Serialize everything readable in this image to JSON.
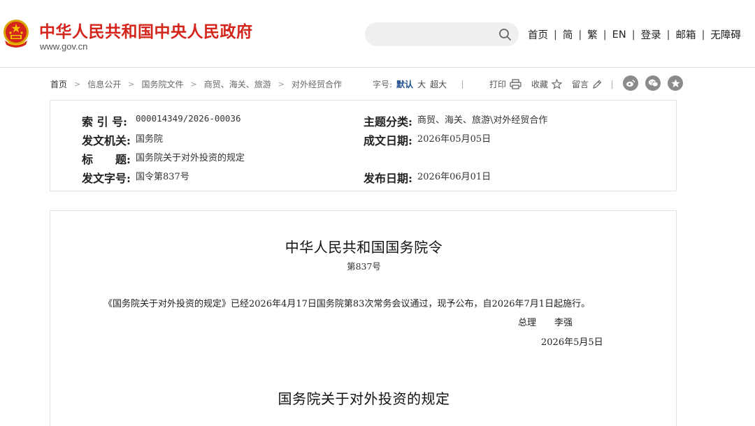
{
  "header": {
    "site_title": "中华人民共和国中央人民政府",
    "site_url": "www.gov.cn",
    "search": {
      "placeholder": ""
    },
    "nav": [
      {
        "label": "首页"
      },
      {
        "label": "简"
      },
      {
        "label": "繁"
      },
      {
        "label": "EN"
      },
      {
        "label": "登录"
      },
      {
        "label": "邮箱"
      },
      {
        "label": "无障碍"
      }
    ],
    "nav_separator": "|"
  },
  "breadcrumb": {
    "items": [
      "首页",
      "信息公开",
      "国务院文件",
      "商贸、海关、旅游",
      "对外经贸合作"
    ],
    "separator": ">"
  },
  "font_size": {
    "label": "字号:",
    "options": [
      "默认",
      "大",
      "超大"
    ],
    "selected": "默认"
  },
  "tools": {
    "print": "打印",
    "favorite": "收藏",
    "comment": "留言"
  },
  "share": {
    "icons": [
      "weibo-icon",
      "wechat-icon",
      "qzone-icon"
    ]
  },
  "metadata": {
    "index_label": "索 引 号:",
    "index_value": "000014349/2026-00036",
    "topic_label": "主题分类:",
    "topic_value": "商贸、海关、旅游\\对外经贸合作",
    "issuer_label": "发文机关:",
    "issuer_value": "国务院",
    "date_written_label": "成文日期:",
    "date_written_value": "2026年05月05日",
    "title_label": "标　　题:",
    "title_value": "国务院关于对外投资的规定",
    "doc_no_label": "发文字号:",
    "doc_no_value": "国令第837号",
    "publish_date_label": "发布日期:",
    "publish_date_value": "2026年06月01日"
  },
  "article": {
    "title": "中华人民共和国国务院令",
    "number": "第837号",
    "paragraph": "《国务院关于对外投资的规定》已经2026年4月17日国务院第83次常务会议通过，现予公布，自2026年7月1日起施行。",
    "signer_title": "总理",
    "signer_name": "李强",
    "sign_date": "2026年5月5日",
    "subtitle": "国务院关于对外投资的规定"
  },
  "colors": {
    "brand_red": "#d4251c",
    "active_blue": "#1f4e8c",
    "share_gray": "#8b8b8b"
  }
}
